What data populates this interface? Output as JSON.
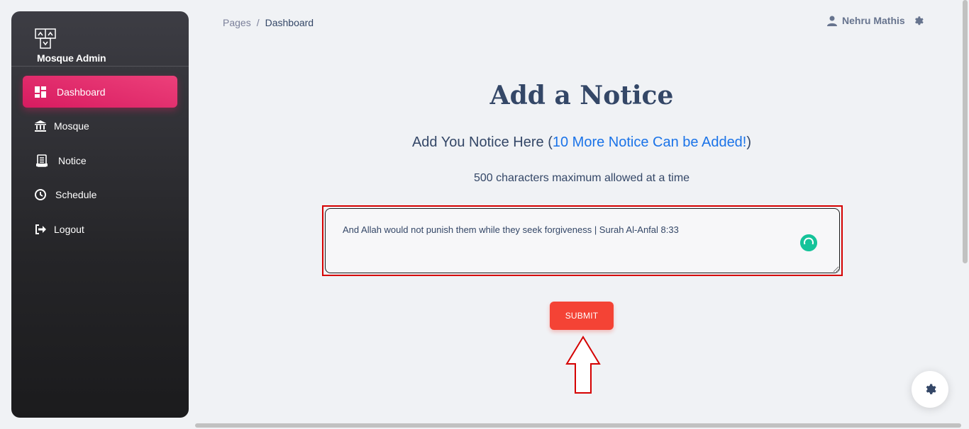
{
  "sidebar": {
    "brand": "Mosque Admin",
    "items": [
      {
        "label": "Dashboard",
        "icon": "dashboard-icon",
        "active": true
      },
      {
        "label": "Mosque",
        "icon": "mosque-icon",
        "active": false
      },
      {
        "label": "Notice",
        "icon": "notice-icon",
        "active": false
      },
      {
        "label": "Schedule",
        "icon": "clock-icon",
        "active": false
      },
      {
        "label": "Logout",
        "icon": "logout-icon",
        "active": false
      }
    ]
  },
  "header": {
    "breadcrumb": {
      "parent": "Pages",
      "separator": "/",
      "current": "Dashboard"
    },
    "user_name": "Nehru Mathis"
  },
  "main": {
    "title": "Add a Notice",
    "subtitle_prefix": "Add You Notice Here (",
    "subtitle_link": "10 More Notice Can be Added!",
    "subtitle_suffix": ")",
    "hint": "500 characters maximum allowed at a time",
    "notice_text": "And Allah would not punish them while they seek forgiveness | Surah Al-Anfal 8:33",
    "submit_label": "SUBMIT"
  },
  "colors": {
    "accent": "#e91e63",
    "submit": "#f44335",
    "link": "#1a73e8",
    "text_dark": "#344767",
    "annotation": "#d50000",
    "grammar_badge": "#15c39a"
  }
}
